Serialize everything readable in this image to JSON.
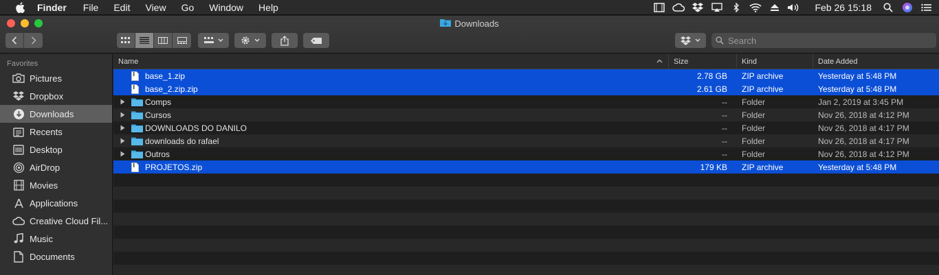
{
  "menubar": {
    "app": "Finder",
    "items": [
      "File",
      "Edit",
      "View",
      "Go",
      "Window",
      "Help"
    ],
    "clock": "Feb 26  15:18"
  },
  "window": {
    "title": "Downloads",
    "search_placeholder": "Search"
  },
  "sidebar": {
    "heading": "Favorites",
    "items": [
      {
        "label": "Pictures",
        "icon": "camera-icon"
      },
      {
        "label": "Dropbox",
        "icon": "dropbox-icon"
      },
      {
        "label": "Downloads",
        "icon": "download-icon",
        "selected": true
      },
      {
        "label": "Recents",
        "icon": "recents-icon"
      },
      {
        "label": "Desktop",
        "icon": "desktop-icon"
      },
      {
        "label": "AirDrop",
        "icon": "airdrop-icon"
      },
      {
        "label": "Movies",
        "icon": "film-icon"
      },
      {
        "label": "Applications",
        "icon": "applications-icon"
      },
      {
        "label": "Creative Cloud Fil...",
        "icon": "creative-cloud-icon"
      },
      {
        "label": "Music",
        "icon": "music-icon"
      },
      {
        "label": "Documents",
        "icon": "document-icon"
      }
    ]
  },
  "columns": {
    "name": "Name",
    "size": "Size",
    "kind": "Kind",
    "date": "Date Added"
  },
  "files": [
    {
      "name": "base_1.zip",
      "size": "2.78 GB",
      "kind": "ZIP archive",
      "date": "Yesterday at 5:48 PM",
      "type": "zip",
      "selected": true
    },
    {
      "name": "base_2.zip.zip",
      "size": "2.61 GB",
      "kind": "ZIP archive",
      "date": "Yesterday at 5:48 PM",
      "type": "zip",
      "selected": true
    },
    {
      "name": "Comps",
      "size": "--",
      "kind": "Folder",
      "date": "Jan 2, 2019 at 3:45 PM",
      "type": "folder",
      "selected": false
    },
    {
      "name": "Cursos",
      "size": "--",
      "kind": "Folder",
      "date": "Nov 26, 2018 at 4:12 PM",
      "type": "folder",
      "selected": false
    },
    {
      "name": "DOWNLOADS DO DANILO",
      "size": "--",
      "kind": "Folder",
      "date": "Nov 26, 2018 at 4:17 PM",
      "type": "folder",
      "selected": false
    },
    {
      "name": "downloads do rafael",
      "size": "--",
      "kind": "Folder",
      "date": "Nov 26, 2018 at 4:17 PM",
      "type": "folder",
      "selected": false
    },
    {
      "name": "Outros",
      "size": "--",
      "kind": "Folder",
      "date": "Nov 26, 2018 at 4:12 PM",
      "type": "folder",
      "selected": false
    },
    {
      "name": "PROJETOS.zip",
      "size": "179 KB",
      "kind": "ZIP archive",
      "date": "Yesterday at 5:48 PM",
      "type": "zip",
      "selected": true
    }
  ],
  "colors": {
    "selection": "#0b4fd6",
    "folder": "#3aa7e0"
  }
}
